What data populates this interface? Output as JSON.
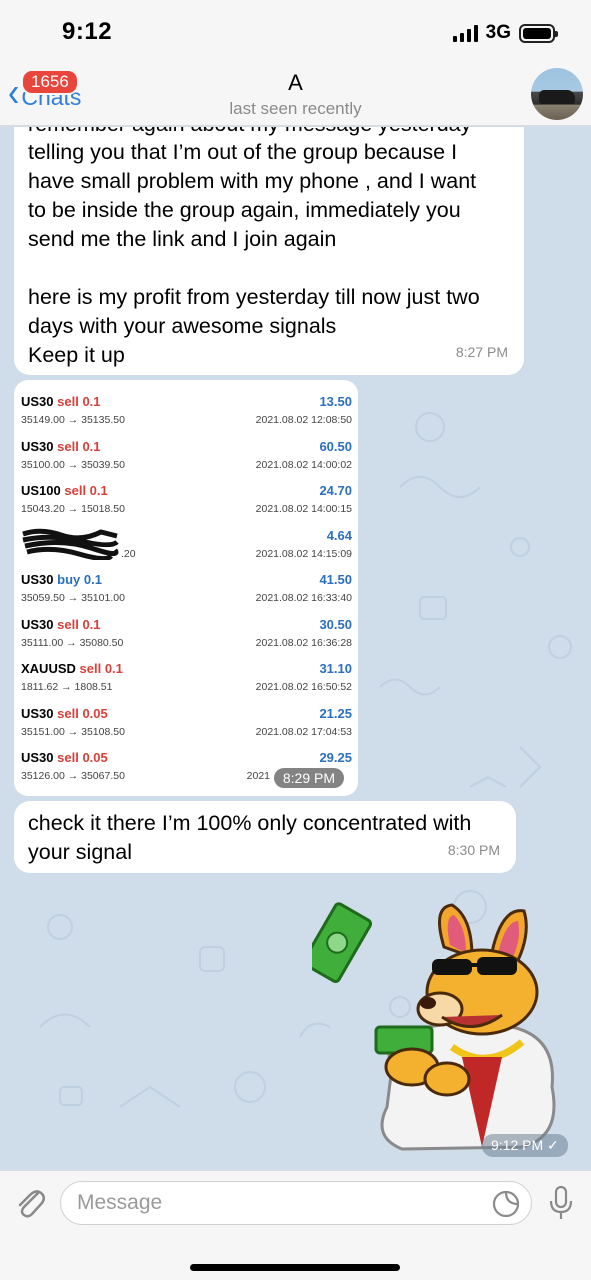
{
  "status_bar": {
    "time": "9:12",
    "network": "3G",
    "icons": [
      "signal-icon",
      "battery-icon"
    ]
  },
  "header": {
    "back_label": "Chats",
    "unread_badge": "1656",
    "contact_name": "A",
    "contact_status": "last seen recently"
  },
  "messages": {
    "msg1": {
      "cut_line": "remember again about my message yesterday",
      "lines": [
        "telling you that I’m out of the group because I",
        "have small problem with my phone , and I want",
        "to be inside the group again, immediately you",
        "send me the link and I join again",
        "",
        "here is my profit from yesterday till now just two",
        "days with your awesome signals",
        "Keep it up"
      ],
      "time": "8:27 PM"
    },
    "photo": {
      "time": "8:29 PM",
      "trades": [
        {
          "symbol": "US30",
          "action": "sell 0.1",
          "prices": "35149.00 → 35135.50",
          "profit": "13.50",
          "datetime": "2021.08.02 12:08:50"
        },
        {
          "symbol": "US30",
          "action": "sell 0.1",
          "prices": "35100.00 → 35039.50",
          "profit": "60.50",
          "datetime": "2021.08.02 14:00:02"
        },
        {
          "symbol": "US100",
          "action": "sell 0.1",
          "prices": "15043.20 → 15018.50",
          "profit": "24.70",
          "datetime": "2021.08.02 14:00:15"
        },
        {
          "symbol": "",
          "action": "",
          "prices": ".20",
          "profit": "4.64",
          "datetime": "2021.08.02 14:15:09",
          "redacted": true
        },
        {
          "symbol": "US30",
          "action": "buy 0.1",
          "prices": "35059.50 → 35101.00",
          "profit": "41.50",
          "datetime": "2021.08.02 16:33:40"
        },
        {
          "symbol": "US30",
          "action": "sell 0.1",
          "prices": "35111.00 → 35080.50",
          "profit": "30.50",
          "datetime": "2021.08.02 16:36:28"
        },
        {
          "symbol": "XAUUSD",
          "action": "sell 0.1",
          "prices": "1811.62 → 1808.51",
          "profit": "31.10",
          "datetime": "2021.08.02 16:50:52"
        },
        {
          "symbol": "US30",
          "action": "sell 0.05",
          "prices": "35151.00 → 35108.50",
          "profit": "21.25",
          "datetime": "2021.08.02 17:04:53"
        },
        {
          "symbol": "US30",
          "action": "sell 0.05",
          "prices": "35126.00 → 35067.50",
          "profit": "29.25",
          "datetime": "2021"
        }
      ]
    },
    "msg3": {
      "lines": [
        "check it there I’m 100% only concentrated with",
        "your signal"
      ],
      "time": "8:30 PM"
    },
    "sticker": {
      "time": "9:12 PM ✓"
    }
  },
  "input": {
    "placeholder": "Message"
  },
  "colors": {
    "accent": "#2f7ed8",
    "badge": "#e8453c",
    "sell": "#d9403a",
    "profit": "#2a6fc1",
    "chat_bg": "#cfdcea"
  }
}
